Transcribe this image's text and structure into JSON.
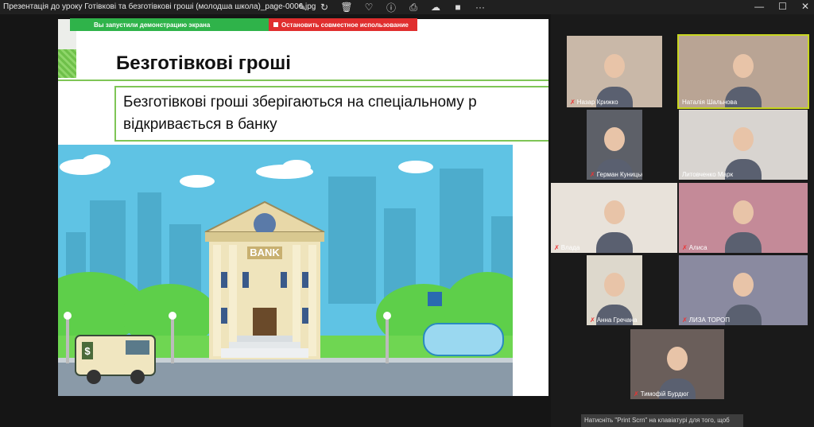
{
  "window": {
    "title": "Презентація до уроку Готівкові та безготівкові гроші (молодша школа)_page-0006.jpg",
    "toolbar": [
      {
        "icon": "edit-icon",
        "glyph": "✎"
      },
      {
        "icon": "rotate-icon",
        "glyph": "↻"
      },
      {
        "icon": "delete-icon",
        "glyph": "🗑"
      },
      {
        "icon": "favorite-icon",
        "glyph": "♡"
      },
      {
        "icon": "info-icon",
        "glyph": "ⓘ"
      },
      {
        "icon": "print-icon",
        "glyph": "⎙"
      },
      {
        "icon": "cloud-off-icon",
        "glyph": "☁"
      },
      {
        "icon": "editor-app-icon",
        "glyph": "■"
      },
      {
        "icon": "more-icon",
        "glyph": "···"
      }
    ],
    "controls": {
      "minimize": "—",
      "maximize": "☐",
      "close": "✕"
    }
  },
  "share_bar": {
    "status": "Вы запустили демонстрацию экрана",
    "stop": "Остановить совместное использование"
  },
  "slide": {
    "title": "Безготівкові гроші",
    "definition_line1": "Безготівкові гроші зберігаються на спеціальному р",
    "definition_line2": "відкривається в банку",
    "bank_sign": "BANK",
    "van_sign": "$"
  },
  "participants": [
    {
      "name": "Назар Крижко",
      "bg": "#c9b8a8",
      "muted": true
    },
    {
      "name": "Наталія Шальнова",
      "bg": "#b9a494",
      "muted": false,
      "active": true
    },
    {
      "name": "Герман Куницький",
      "bg": "#5d6068",
      "muted": true
    },
    {
      "name": "Литовченко Марк",
      "bg": "#d8d4d0",
      "muted": false
    },
    {
      "name": "Влада",
      "bg": "#e8e2da",
      "muted": true
    },
    {
      "name": "Алиса",
      "bg": "#c48a98",
      "muted": true
    },
    {
      "name": "Анна Гречана",
      "bg": "#ddd8cc",
      "muted": true
    },
    {
      "name": "ЛИЗА ТОРОП",
      "bg": "#8a8aa0",
      "muted": true
    },
    {
      "name": "Тимофій Бурдюг",
      "bg": "#6a5e5a",
      "muted": true
    }
  ],
  "tooltip": "Натисніть \"Print Scrn\" на клавіатурі для того, щоб"
}
